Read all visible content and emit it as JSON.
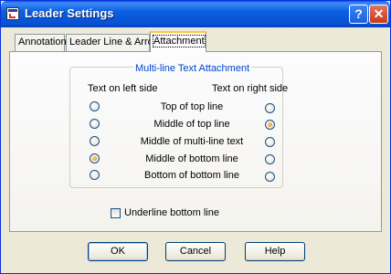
{
  "window": {
    "title": "Leader Settings",
    "help_button": "?",
    "close_button": "✕"
  },
  "tabs": [
    {
      "label": "Annotation",
      "active": false
    },
    {
      "label": "Leader Line & Arrow",
      "active": false
    },
    {
      "label": "Attachment",
      "active": true
    }
  ],
  "attachment": {
    "group_title": "Multi-line Text Attachment",
    "left_header": "Text on left side",
    "right_header": "Text on right side",
    "options": [
      {
        "label": "Top of top line",
        "left_checked": false,
        "right_checked": false
      },
      {
        "label": "Middle of top line",
        "left_checked": false,
        "right_checked": true
      },
      {
        "label": "Middle of multi-line text",
        "left_checked": false,
        "right_checked": false
      },
      {
        "label": "Middle of bottom line",
        "left_checked": true,
        "right_checked": false
      },
      {
        "label": "Bottom of bottom line",
        "left_checked": false,
        "right_checked": false
      }
    ],
    "underline_label": "Underline bottom line",
    "underline_checked": false
  },
  "buttons": {
    "ok": "OK",
    "cancel": "Cancel",
    "help": "Help"
  },
  "colors": {
    "titlebar": "#0751d4",
    "group_title": "#0046d5",
    "active_tab_accent": "#ffc83c",
    "radio_dot": "#e08a12"
  }
}
